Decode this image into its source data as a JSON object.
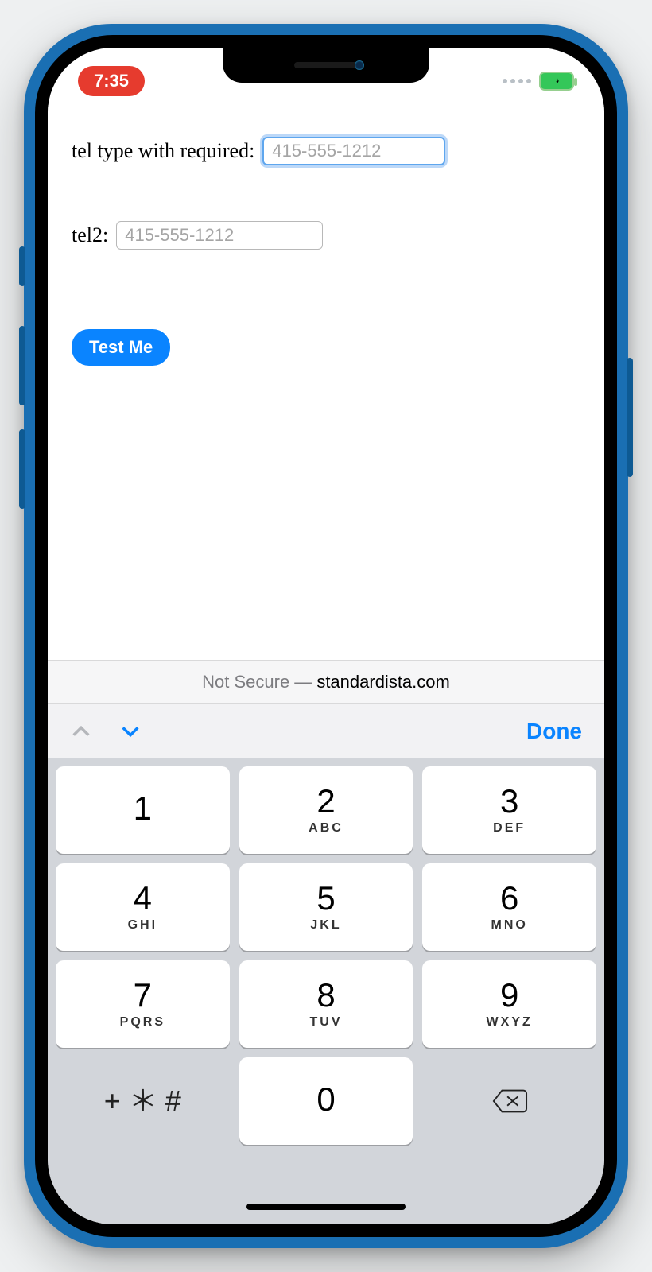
{
  "status": {
    "time": "7:35"
  },
  "form": {
    "tel1": {
      "label": "tel type with required:",
      "placeholder": "415-555-1212"
    },
    "tel2": {
      "label": "tel2:",
      "placeholder": "415-555-1212"
    },
    "button_label": "Test Me"
  },
  "urlbar": {
    "prefix": "Not Secure —",
    "domain": "standardista.com"
  },
  "accessory": {
    "done": "Done"
  },
  "keypad": {
    "k1": {
      "n": "1",
      "s": ""
    },
    "k2": {
      "n": "2",
      "s": "ABC"
    },
    "k3": {
      "n": "3",
      "s": "DEF"
    },
    "k4": {
      "n": "4",
      "s": "GHI"
    },
    "k5": {
      "n": "5",
      "s": "JKL"
    },
    "k6": {
      "n": "6",
      "s": "MNO"
    },
    "k7": {
      "n": "7",
      "s": "PQRS"
    },
    "k8": {
      "n": "8",
      "s": "TUV"
    },
    "k9": {
      "n": "9",
      "s": "WXYZ"
    },
    "sym": "+ ＊ #",
    "k0": {
      "n": "0",
      "s": ""
    }
  }
}
